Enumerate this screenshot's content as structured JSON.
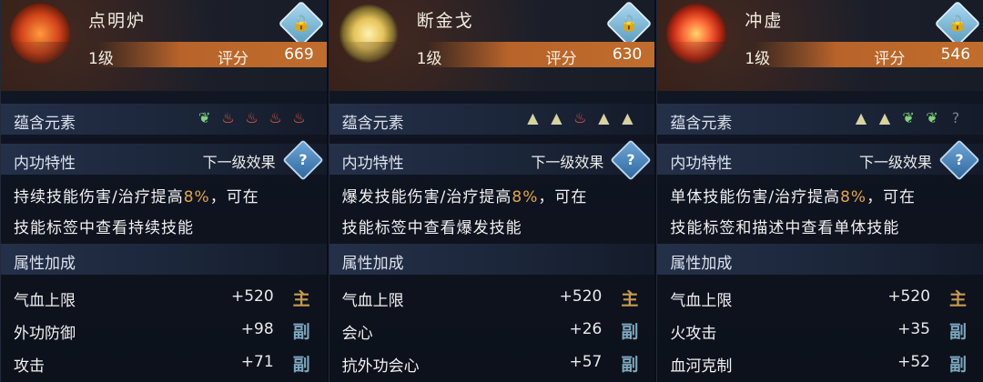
{
  "cards": [
    {
      "name": "点明炉",
      "level": "1级",
      "score_label": "评分",
      "score": "669",
      "section_elements": "蕴含元素",
      "elements": [
        "wood",
        "fire",
        "fire",
        "fire",
        "fire"
      ],
      "section_internal": "内功特性",
      "next_effect": "下一级效果",
      "desc_line1a": "持续技能伤害/治疗提高",
      "desc_pct": "8%",
      "desc_line1b": "，可在",
      "desc_line2": "技能标签中查看持续技能",
      "section_attrs": "属性加成",
      "attrs": [
        {
          "name": "气血上限",
          "value": "+520",
          "tag": "主"
        },
        {
          "name": "外功防御",
          "value": "+98",
          "tag": "副"
        },
        {
          "name": "攻击",
          "value": "+71",
          "tag": "副"
        }
      ]
    },
    {
      "name": "断金戈",
      "level": "1级",
      "score_label": "评分",
      "score": "630",
      "section_elements": "蕴含元素",
      "elements": [
        "metal",
        "metal",
        "fire",
        "metal",
        "metal"
      ],
      "section_internal": "内功特性",
      "next_effect": "下一级效果",
      "desc_line1a": "爆发技能伤害/治疗提高",
      "desc_pct": "8%",
      "desc_line1b": "，可在",
      "desc_line2": "技能标签中查看爆发技能",
      "section_attrs": "属性加成",
      "attrs": [
        {
          "name": "气血上限",
          "value": "+520",
          "tag": "主"
        },
        {
          "name": "会心",
          "value": "+26",
          "tag": "副"
        },
        {
          "name": "抗外功会心",
          "value": "+57",
          "tag": "副"
        }
      ]
    },
    {
      "name": "冲虚",
      "level": "1级",
      "score_label": "评分",
      "score": "546",
      "section_elements": "蕴含元素",
      "elements": [
        "metal",
        "metal",
        "wood",
        "wood",
        "none"
      ],
      "section_internal": "内功特性",
      "next_effect": "下一级效果",
      "desc_line1a": "单体技能伤害/治疗提高",
      "desc_pct": "8%",
      "desc_line1b": "，可在",
      "desc_line2": "技能标签和描述中查看单体技能",
      "section_attrs": "属性加成",
      "attrs": [
        {
          "name": "气血上限",
          "value": "+520",
          "tag": "主"
        },
        {
          "name": "火攻击",
          "value": "+35",
          "tag": "副"
        },
        {
          "name": "血河克制",
          "value": "+52",
          "tag": "副"
        }
      ]
    }
  ],
  "icons": {
    "lock": "lock-icon",
    "help": "help-icon",
    "element_glyphs": {
      "wood": "❦",
      "fire": "♨",
      "metal": "▲",
      "none": "?"
    }
  },
  "colors": {
    "accent_orange": "#c06d2c",
    "percent": "#e5a547",
    "main_tag": "#c89a4e",
    "sub_tag": "#7ca6bd"
  }
}
